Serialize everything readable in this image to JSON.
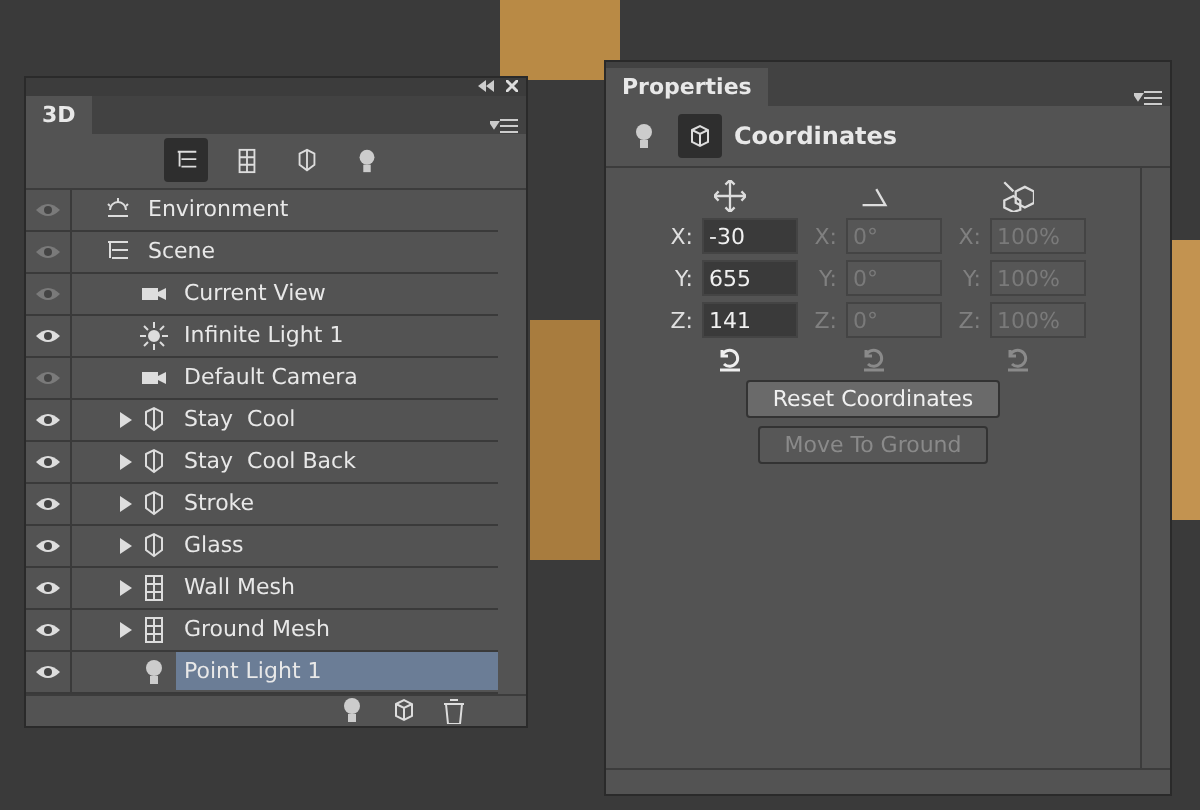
{
  "panel_3d": {
    "tab": "3D",
    "filters": [
      {
        "kind": "scene",
        "selected": true
      },
      {
        "kind": "mesh",
        "selected": false
      },
      {
        "kind": "material",
        "selected": false
      },
      {
        "kind": "bulb",
        "selected": false
      }
    ],
    "rows": [
      {
        "label": "Environment",
        "kind": "environment",
        "visible": false,
        "expandable": false,
        "selected": false
      },
      {
        "label": "Scene",
        "kind": "scene",
        "visible": false,
        "expandable": false,
        "selected": false,
        "children": [
          {
            "label": "Current View",
            "kind": "camera",
            "visible": false,
            "expandable": false,
            "selected": false
          },
          {
            "label": "Infinite Light 1",
            "kind": "sun",
            "visible": true,
            "expandable": false,
            "selected": false
          },
          {
            "label": "Default Camera",
            "kind": "camera",
            "visible": false,
            "expandable": false,
            "selected": false
          },
          {
            "label": "Stay  Cool",
            "kind": "material",
            "visible": true,
            "expandable": true,
            "selected": false
          },
          {
            "label": "Stay  Cool Back",
            "kind": "material",
            "visible": true,
            "expandable": true,
            "selected": false
          },
          {
            "label": "Stroke",
            "kind": "material",
            "visible": true,
            "expandable": true,
            "selected": false
          },
          {
            "label": "Glass",
            "kind": "material",
            "visible": true,
            "expandable": true,
            "selected": false
          },
          {
            "label": "Wall Mesh",
            "kind": "mesh",
            "visible": true,
            "expandable": true,
            "selected": false
          },
          {
            "label": "Ground Mesh",
            "kind": "mesh",
            "visible": true,
            "expandable": true,
            "selected": false
          },
          {
            "label": "Point Light 1",
            "kind": "bulb",
            "visible": true,
            "expandable": false,
            "selected": true
          }
        ]
      }
    ]
  },
  "properties": {
    "tab": "Properties",
    "modes": [
      {
        "kind": "bulb",
        "selected": false
      },
      {
        "kind": "coords",
        "selected": true
      }
    ],
    "title": "Coordinates",
    "groups": [
      {
        "kind": "move",
        "disabled": false,
        "fields": [
          {
            "label": "X:",
            "value": "-30"
          },
          {
            "label": "Y:",
            "value": "655"
          },
          {
            "label": "Z:",
            "value": "141"
          }
        ]
      },
      {
        "kind": "rotate",
        "disabled": true,
        "fields": [
          {
            "label": "X:",
            "value": "0°"
          },
          {
            "label": "Y:",
            "value": "0°"
          },
          {
            "label": "Z:",
            "value": "0°"
          }
        ]
      },
      {
        "kind": "scale",
        "disabled": true,
        "fields": [
          {
            "label": "X:",
            "value": "100%"
          },
          {
            "label": "Y:",
            "value": "100%"
          },
          {
            "label": "Z:",
            "value": "100%"
          }
        ]
      }
    ],
    "buttons": [
      {
        "label": "Reset Coordinates",
        "disabled": false
      },
      {
        "label": "Move To Ground",
        "disabled": true
      }
    ]
  }
}
